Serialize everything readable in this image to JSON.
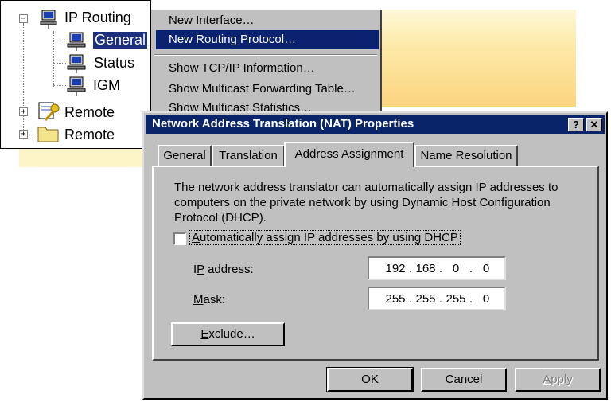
{
  "tree": {
    "items": [
      {
        "label": "IP Routing",
        "expander": "−",
        "icon": "network-computer-icon"
      },
      {
        "label": "General",
        "icon": "network-computer-icon",
        "selected": true
      },
      {
        "label": "Status",
        "icon": "network-computer-icon"
      },
      {
        "label": "IGM",
        "icon": "network-computer-icon"
      },
      {
        "label": "Remote",
        "expander": "+",
        "icon": "key-document-icon"
      },
      {
        "label": "Remote",
        "expander": "+",
        "icon": "folder-icon"
      }
    ]
  },
  "menu": {
    "items": [
      {
        "label": "New Interface…"
      },
      {
        "label": "New Routing Protocol…",
        "highlighted": true
      },
      {
        "label": "Show TCP/IP Information…"
      },
      {
        "label": "Show Multicast Forwarding Table…"
      },
      {
        "label": "Show Multicast Statistics…"
      }
    ]
  },
  "dialog": {
    "title": "Network Address Translation (NAT) Properties",
    "help_glyph": "?",
    "close_glyph": "✕",
    "tabs": [
      "General",
      "Translation",
      "Address Assignment",
      "Name Resolution"
    ],
    "active_tab": "Address Assignment",
    "description": "The network address translator can automatically assign IP addresses to computers on the private network by using Dynamic Host Configuration Protocol (DHCP).",
    "checkbox": {
      "label_accel": "A",
      "label_rest": "utomatically assign IP addresses by using DHCP",
      "checked": false
    },
    "ip": {
      "label_pre": "I",
      "label_accel": "P",
      "label_rest": " address:",
      "octets": [
        "192",
        "168",
        "0",
        "0"
      ]
    },
    "mask": {
      "label_accel": "M",
      "label_rest": "ask:",
      "octets": [
        "255",
        "255",
        "255",
        "0"
      ]
    },
    "exclude": {
      "accel": "E",
      "rest": "xclude…"
    },
    "ok_label": "OK",
    "cancel_label": "Cancel",
    "apply": {
      "accel": "A",
      "rest": "pply"
    }
  },
  "colors": {
    "titlebar": "#0a246a",
    "selection": "#0a2270",
    "face": "#c0c0c0"
  }
}
